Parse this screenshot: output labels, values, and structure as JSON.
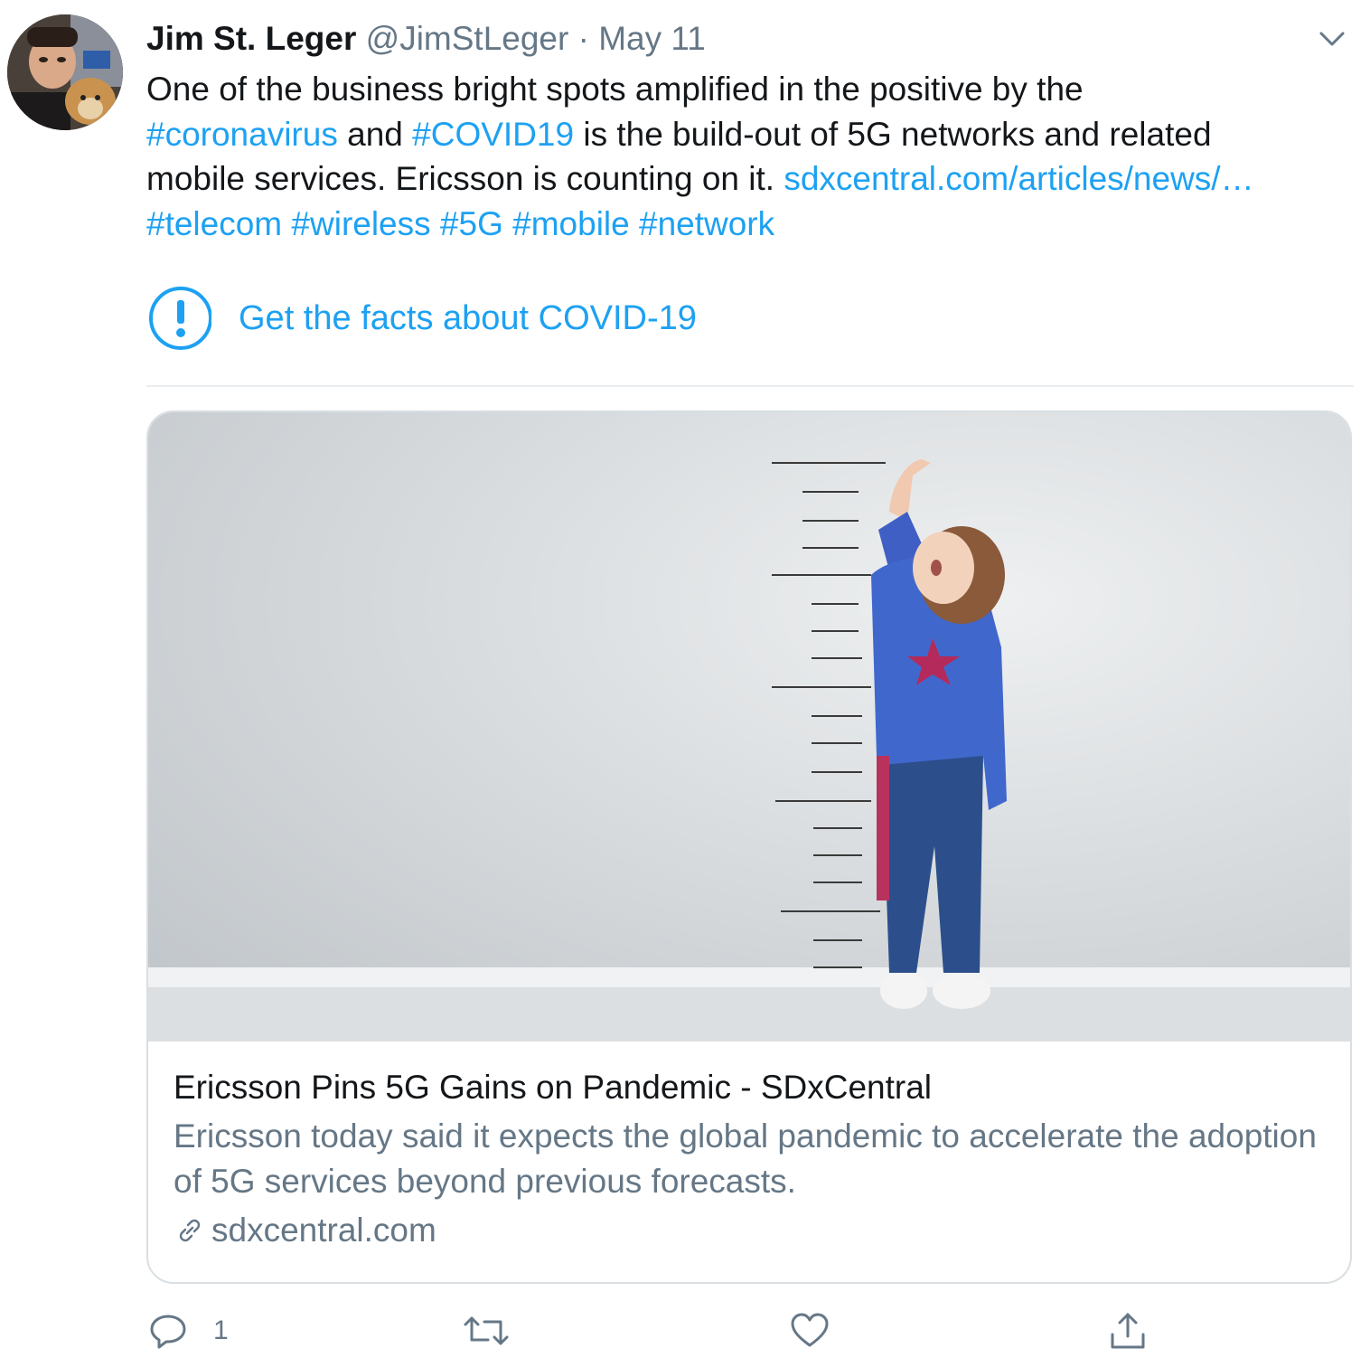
{
  "tweet": {
    "author_name": "Jim St. Leger",
    "handle": "@JimStLeger",
    "separator": "·",
    "date": "May 11",
    "text_lines": [
      [
        {
          "t": "One of the business bright spots amplified in the positive by the",
          "link": false
        }
      ],
      [
        {
          "t": "#coronavirus",
          "link": true
        },
        {
          "t": " and ",
          "link": false
        },
        {
          "t": "#COVID19",
          "link": true
        },
        {
          "t": " is the build-out of 5G networks and related",
          "link": false
        }
      ],
      [
        {
          "t": "mobile services. Ericsson is counting on it. ",
          "link": false
        },
        {
          "t": "sdxcentral.com/articles/news/…",
          "link": true
        }
      ],
      [
        {
          "t": "#telecom",
          "link": true
        },
        {
          "t": " ",
          "link": false
        },
        {
          "t": "#wireless",
          "link": true
        },
        {
          "t": " ",
          "link": false
        },
        {
          "t": "#5G",
          "link": true
        },
        {
          "t": " ",
          "link": false
        },
        {
          "t": "#mobile",
          "link": true
        },
        {
          "t": " ",
          "link": false
        },
        {
          "t": "#network",
          "link": true
        }
      ]
    ],
    "facts_link": "Get the facts about COVID-19",
    "card": {
      "title": "Ericsson Pins 5G Gains on Pandemic - SDxCentral",
      "description": "Ericsson today said it expects the global pandemic to accelerate the adoption of 5G services beyond previous forecasts.",
      "domain": "sdxcentral.com"
    },
    "actions": {
      "reply_count": "1",
      "retweet_count": "",
      "like_count": ""
    }
  },
  "colors": {
    "link": "#1da1f2",
    "secondary_text": "#657786",
    "primary_text": "#14171a",
    "border": "#d9dfe3"
  },
  "icons": [
    "chevron-down-icon",
    "exclamation-circle-icon",
    "link-icon",
    "reply-icon",
    "retweet-icon",
    "like-icon",
    "share-icon"
  ]
}
